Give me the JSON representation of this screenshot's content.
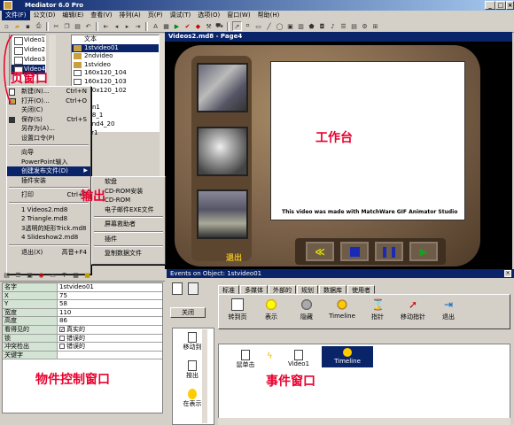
{
  "window": {
    "title": "Mediator 6.0 Pro"
  },
  "menubar": [
    "文件(F)",
    "公文(D)",
    "编辑(E)",
    "查看(V)",
    "排列(A)",
    "页(P)",
    "调试(T)",
    "选项(O)",
    "窗口(W)",
    "帮助(H)"
  ],
  "pages": [
    "Video1",
    "Video2",
    "Video3",
    "Video4"
  ],
  "objects": {
    "header": "文本",
    "items": [
      "1stvideo01",
      "2ndvideo",
      "1stvideo",
      "160x120_104",
      "160x120_103",
      "160x120_102",
      "",
      "tain1",
      "288_1",
      "ound4_20",
      "ker1"
    ]
  },
  "file_menu": {
    "items": [
      {
        "label": "新建(N)...",
        "shortcut": "Ctrl+N"
      },
      {
        "label": "打开(O)...",
        "shortcut": "Ctrl+O"
      },
      {
        "label": "关闭(C)",
        "shortcut": ""
      },
      {
        "label": "保存(S)",
        "shortcut": "Ctrl+S"
      },
      {
        "label": "另存为(A)...",
        "shortcut": ""
      },
      {
        "label": "设置口令(P)",
        "shortcut": ""
      },
      {
        "label": "向导",
        "shortcut": ""
      },
      {
        "label": "PowerPoint输入",
        "shortcut": ""
      },
      {
        "label": "创建发布文件(D)",
        "shortcut": ""
      },
      {
        "label": "插件安装",
        "shortcut": ""
      },
      {
        "label": "打印",
        "shortcut": "Ctrl+P"
      },
      {
        "label": "1 Videos2.md8",
        "shortcut": ""
      },
      {
        "label": "2 Triangle.md8",
        "shortcut": ""
      },
      {
        "label": "3透明的矩形Trick.md8",
        "shortcut": ""
      },
      {
        "label": "4 Slideshow2.md8",
        "shortcut": ""
      },
      {
        "label": "退出(X)",
        "shortcut": "高音+F4"
      }
    ]
  },
  "submenu": [
    "软盘",
    "CD-ROM安装",
    "CD-ROM",
    "电子邮件EXE文件",
    "屏幕救助者",
    "插件",
    "复制数据文件"
  ],
  "work": {
    "tab_title": "Videos2.md8 - Page4",
    "caption": "This video was made with MatchWare GIF Animator Studio",
    "exit_label": "退出"
  },
  "properties": [
    {
      "name": "名字",
      "value": "1stvideo01"
    },
    {
      "name": "X",
      "value": "75"
    },
    {
      "name": "Y",
      "value": "58"
    },
    {
      "name": "宽度",
      "value": "110"
    },
    {
      "name": "高度",
      "value": "86"
    },
    {
      "name": "看得见的",
      "value": "真实的",
      "checked": true
    },
    {
      "name": "锁",
      "value": "错误的",
      "checked": false
    },
    {
      "name": "冲突检出",
      "value": "错误的",
      "checked": false
    },
    {
      "name": "关键字",
      "value": ""
    }
  ],
  "events": {
    "title": "Events on Object: 1stvideo01",
    "tabs": [
      "标准",
      "多媒体",
      "外部的",
      "规划",
      "数据库",
      "使用者"
    ],
    "actions": [
      "转到页",
      "表示",
      "隐藏",
      "Timeline",
      "指针",
      "移动指针",
      "退出"
    ],
    "close_label": "关闭",
    "triggers": [
      "移动到",
      "按出",
      "在表示"
    ],
    "chain": [
      "鼠单击",
      "Video1",
      "Timeline"
    ]
  },
  "annotations": {
    "page_window": "页窗口",
    "workspace": "工作台",
    "output": "输出",
    "object_control": "物件控制窗口",
    "event_window": "事件窗口"
  },
  "colors": {
    "annotation_red": "#e8002e",
    "selection_blue": "#0a246a"
  }
}
